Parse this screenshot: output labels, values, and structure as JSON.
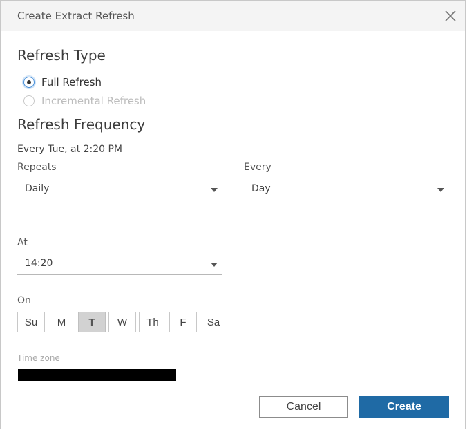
{
  "dialog": {
    "title": "Create Extract Refresh",
    "close_icon": "close-icon"
  },
  "refresh_type": {
    "heading": "Refresh Type",
    "options": [
      {
        "label": "Full Refresh",
        "checked": true,
        "enabled": true
      },
      {
        "label": "Incremental Refresh",
        "checked": false,
        "enabled": false
      }
    ]
  },
  "frequency": {
    "heading": "Refresh Frequency",
    "summary": "Every Tue, at 2:20 PM",
    "repeats": {
      "label": "Repeats",
      "value": "Daily"
    },
    "every": {
      "label": "Every",
      "value": "Day"
    },
    "at": {
      "label": "At",
      "value": "14:20"
    },
    "on": {
      "label": "On",
      "days": [
        {
          "label": "Su",
          "selected": false
        },
        {
          "label": "M",
          "selected": false
        },
        {
          "label": "T",
          "selected": true
        },
        {
          "label": "W",
          "selected": false
        },
        {
          "label": "Th",
          "selected": false
        },
        {
          "label": "F",
          "selected": false
        },
        {
          "label": "Sa",
          "selected": false
        }
      ]
    },
    "time_zone": {
      "label": "Time zone",
      "value_redacted": true
    }
  },
  "buttons": {
    "cancel": "Cancel",
    "create": "Create"
  },
  "colors": {
    "primary": "#1f6aa5",
    "titlebar_bg": "#f4f4f4",
    "selected_day_bg": "#d2d2d2",
    "radio_focus": "#4a90d9"
  }
}
